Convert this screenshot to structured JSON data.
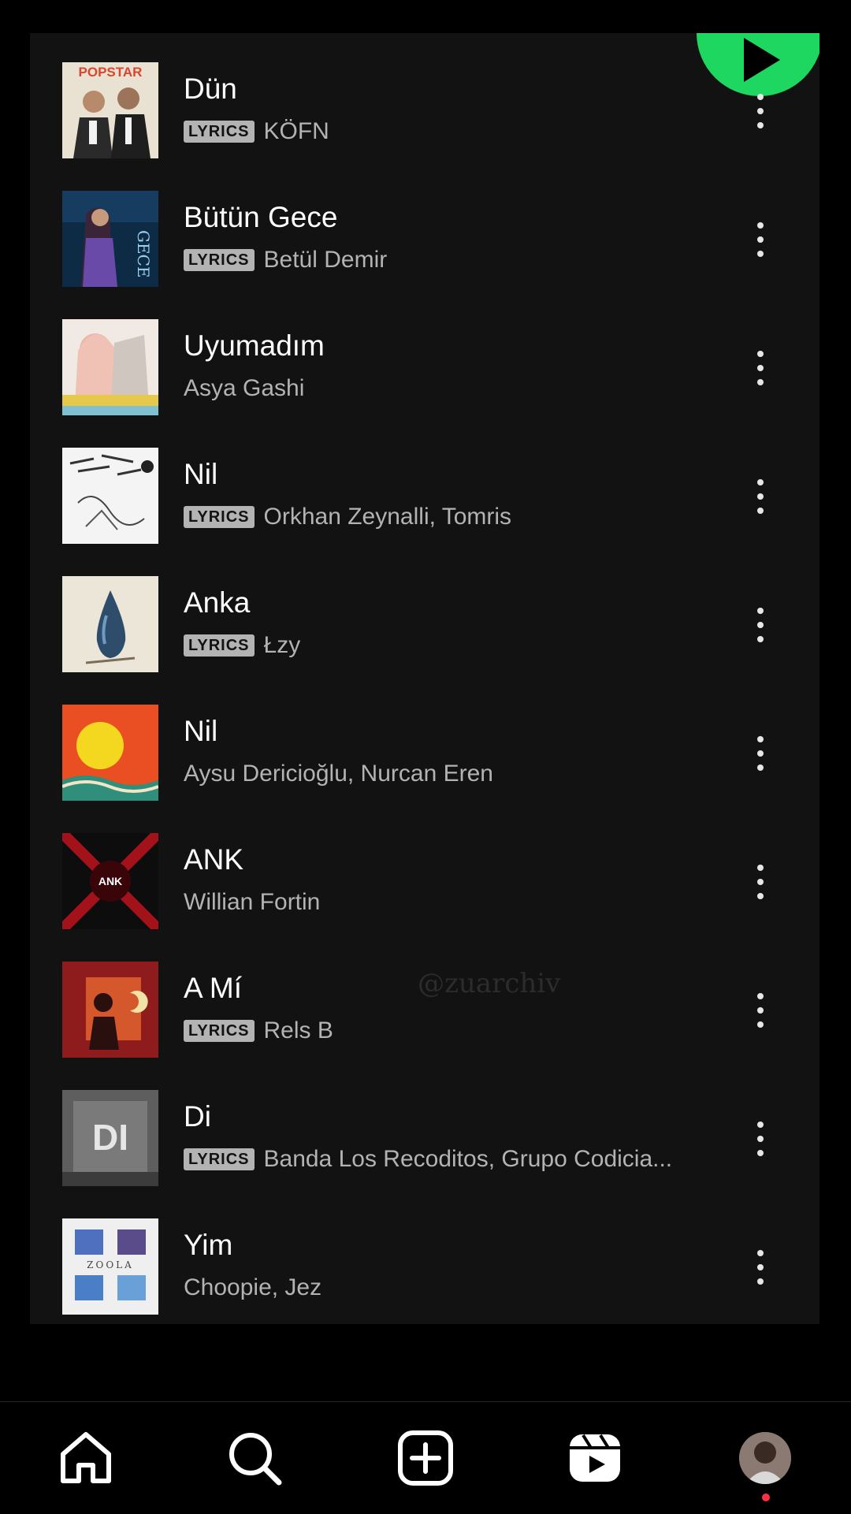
{
  "badge_label": "LYRICS",
  "colors": {
    "accent": "#1ed760",
    "background": "#121212",
    "text_primary": "#ffffff",
    "text_secondary": "#b3b3b3",
    "notification": "#ff3040"
  },
  "tracks": [
    {
      "title": "Dün",
      "artist": "KÖFN",
      "lyrics": true,
      "cover_text": "POPSTAR"
    },
    {
      "title": "Bütün Gece",
      "artist": "Betül Demir",
      "lyrics": true,
      "cover_text": ""
    },
    {
      "title": "Uyumadım",
      "artist": "Asya Gashi",
      "lyrics": false,
      "cover_text": ""
    },
    {
      "title": "Nil",
      "artist": "Orkhan Zeynalli, Tomris",
      "lyrics": true,
      "cover_text": ""
    },
    {
      "title": "Anka",
      "artist": "Łzy",
      "lyrics": true,
      "cover_text": ""
    },
    {
      "title": "Nil",
      "artist": "Aysu Dericioğlu, Nurcan Eren",
      "lyrics": false,
      "cover_text": ""
    },
    {
      "title": "ANK",
      "artist": "Willian Fortin",
      "lyrics": false,
      "cover_text": "ANK"
    },
    {
      "title": "A Mí",
      "artist": "Rels B",
      "lyrics": true,
      "cover_text": ""
    },
    {
      "title": "Di",
      "artist": "Banda Los Recoditos, Grupo Codicia...",
      "lyrics": true,
      "cover_text": "DI"
    },
    {
      "title": "Yim",
      "artist": "Choopie, Jez",
      "lyrics": false,
      "cover_text": "ZOOLA"
    }
  ],
  "watermark": "@zuarchiv",
  "bottom_nav": {
    "items": [
      {
        "name": "home",
        "icon": "home-icon"
      },
      {
        "name": "search",
        "icon": "search-icon"
      },
      {
        "name": "create",
        "icon": "add-square-icon"
      },
      {
        "name": "reels",
        "icon": "reels-icon"
      },
      {
        "name": "profile",
        "icon": "avatar"
      }
    ]
  }
}
